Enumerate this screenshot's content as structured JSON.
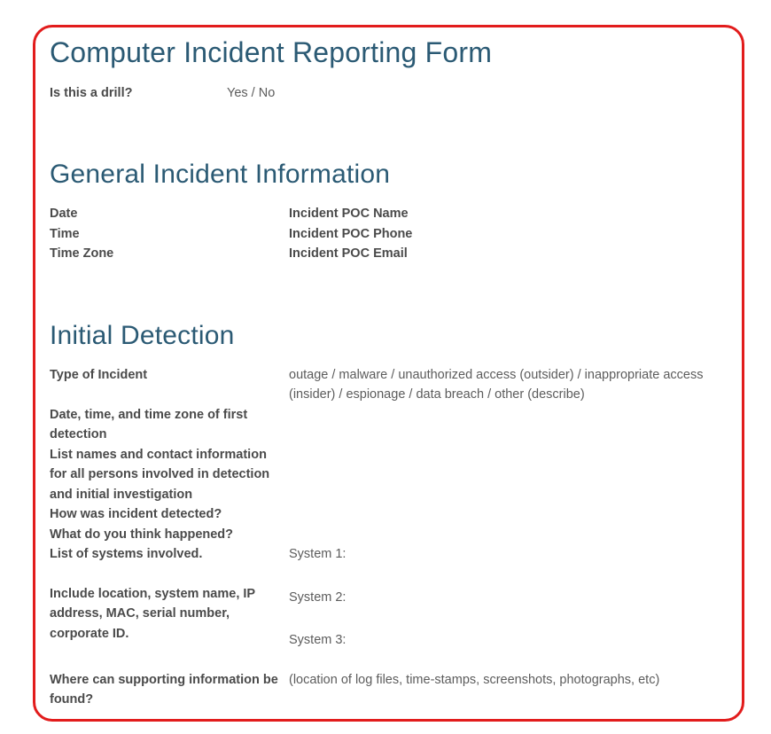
{
  "title": "Computer Incident Reporting Form",
  "drill": {
    "label": "Is this a drill?",
    "value": "Yes / No"
  },
  "general": {
    "heading": "General Incident Information",
    "left": {
      "date": "Date",
      "time": "Time",
      "timezone": "Time Zone"
    },
    "right": {
      "poc_name": "Incident POC Name",
      "poc_phone": "Incident POC Phone",
      "poc_email": "Incident POC Email"
    }
  },
  "detection": {
    "heading": "Initial Detection",
    "type_label": "Type of Incident",
    "type_value": "outage / malware / unauthorized access (outsider) / inappropriate access (insider) / espionage / data breach / other (describe)",
    "first_detection_label": "Date, time, and time zone of first detection",
    "contacts_label": "List names and contact information for all persons involved in detection and initial investigation",
    "how_detected_label": "How was incident detected?",
    "what_happened_label": "What do you think happened?",
    "systems_label": "List of systems involved.",
    "systems_label2": "Include location, system name, IP address, MAC, serial number, corporate ID.",
    "system1": "System 1:",
    "system2": "System 2:",
    "system3": "System 3:",
    "supporting_label": "Where can supporting information be found?",
    "supporting_value": "(location of log files, time-stamps, screenshots, photographs, etc)"
  }
}
